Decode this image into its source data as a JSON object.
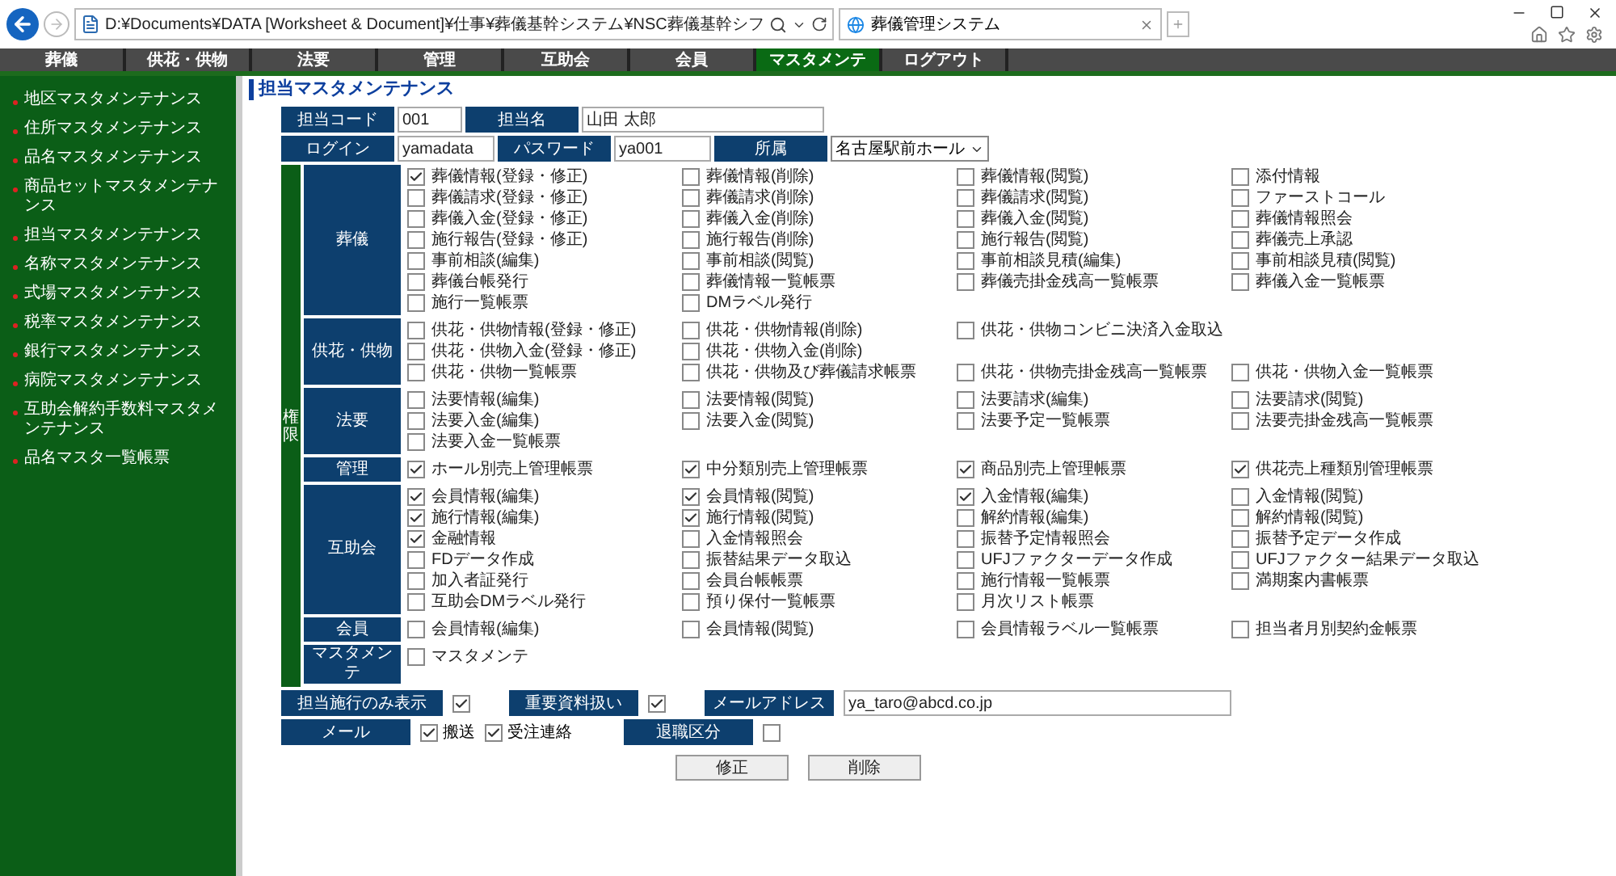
{
  "browser": {
    "address": "D:¥Documents¥DATA [Worksheet & Document]¥仕事¥葬儀基幹システム¥NSC葬儀基幹シフ",
    "tab_title": "葬儀管理システム"
  },
  "nav": [
    {
      "label": "葬儀",
      "selected": false
    },
    {
      "label": "供花・供物",
      "selected": false
    },
    {
      "label": "法要",
      "selected": false
    },
    {
      "label": "管理",
      "selected": false
    },
    {
      "label": "互助会",
      "selected": false
    },
    {
      "label": "会員",
      "selected": false
    },
    {
      "label": "マスタメンテ",
      "selected": true
    },
    {
      "label": "ログアウト",
      "selected": false
    }
  ],
  "sidebar": [
    "地区マスタメンテナンス",
    "住所マスタメンテナンス",
    "品名マスタメンテナンス",
    "商品セットマスタメンテナンス",
    "担当マスタメンテナンス",
    "名称マスタメンテナンス",
    "式場マスタメンテナンス",
    "税率マスタメンテナンス",
    "銀行マスタメンテナンス",
    "病院マスタメンテナンス",
    "互助会解約手数料マスタメンテナンス",
    "品名マスタ一覧帳票"
  ],
  "page_title": "担当マスタメンテナンス",
  "form": {
    "code": {
      "label": "担当コード",
      "value": "001"
    },
    "name": {
      "label": "担当名",
      "value": "山田 太郎"
    },
    "login": {
      "label": "ログイン",
      "value": "yamadata"
    },
    "password": {
      "label": "パスワード",
      "value": "ya001"
    },
    "affiliation": {
      "label": "所属",
      "value": "名古屋駅前ホール"
    },
    "permissions": {
      "label": "権限",
      "sections": [
        {
          "label": "葬儀",
          "rows": [
            [
              {
                "label": "葬儀情報(登録・修正)",
                "checked": true
              },
              {
                "label": "葬儀情報(削除)",
                "checked": false
              },
              {
                "label": "葬儀情報(閲覧)",
                "checked": false
              },
              {
                "label": "添付情報",
                "checked": false
              }
            ],
            [
              {
                "label": "葬儀請求(登録・修正)",
                "checked": false
              },
              {
                "label": "葬儀請求(削除)",
                "checked": false
              },
              {
                "label": "葬儀請求(閲覧)",
                "checked": false
              },
              {
                "label": "ファーストコール",
                "checked": false
              }
            ],
            [
              {
                "label": "葬儀入金(登録・修正)",
                "checked": false
              },
              {
                "label": "葬儀入金(削除)",
                "checked": false
              },
              {
                "label": "葬儀入金(閲覧)",
                "checked": false
              },
              {
                "label": "葬儀情報照会",
                "checked": false
              }
            ],
            [
              {
                "label": "施行報告(登録・修正)",
                "checked": false
              },
              {
                "label": "施行報告(削除)",
                "checked": false
              },
              {
                "label": "施行報告(閲覧)",
                "checked": false
              },
              {
                "label": "葬儀売上承認",
                "checked": false
              }
            ],
            [
              {
                "label": "事前相談(編集)",
                "checked": false
              },
              {
                "label": "事前相談(閲覧)",
                "checked": false
              },
              {
                "label": "事前相談見積(編集)",
                "checked": false
              },
              {
                "label": "事前相談見積(閲覧)",
                "checked": false
              }
            ],
            [
              {
                "label": "葬儀台帳発行",
                "checked": false
              },
              {
                "label": "葬儀情報一覧帳票",
                "checked": false
              },
              {
                "label": "葬儀売掛金残高一覧帳票",
                "checked": false
              },
              {
                "label": "葬儀入金一覧帳票",
                "checked": false
              }
            ],
            [
              {
                "label": "施行一覧帳票",
                "checked": false
              },
              {
                "label": "DMラベル発行",
                "checked": false
              }
            ]
          ]
        },
        {
          "label": "供花・供物",
          "rows": [
            [
              {
                "label": "供花・供物情報(登録・修正)",
                "checked": false
              },
              {
                "label": "供花・供物情報(削除)",
                "checked": false
              },
              {
                "label": "供花・供物コンビニ決済入金取込",
                "checked": false
              }
            ],
            [
              {
                "label": "供花・供物入金(登録・修正)",
                "checked": false
              },
              {
                "label": "供花・供物入金(削除)",
                "checked": false
              }
            ],
            [
              {
                "label": "供花・供物一覧帳票",
                "checked": false
              },
              {
                "label": "供花・供物及び葬儀請求帳票",
                "checked": false
              },
              {
                "label": "供花・供物売掛金残高一覧帳票",
                "checked": false
              },
              {
                "label": "供花・供物入金一覧帳票",
                "checked": false
              }
            ]
          ]
        },
        {
          "label": "法要",
          "rows": [
            [
              {
                "label": "法要情報(編集)",
                "checked": false
              },
              {
                "label": "法要情報(閲覧)",
                "checked": false
              },
              {
                "label": "法要請求(編集)",
                "checked": false
              },
              {
                "label": "法要請求(閲覧)",
                "checked": false
              }
            ],
            [
              {
                "label": "法要入金(編集)",
                "checked": false
              },
              {
                "label": "法要入金(閲覧)",
                "checked": false
              },
              {
                "label": "法要予定一覧帳票",
                "checked": false
              },
              {
                "label": "法要売掛金残高一覧帳票",
                "checked": false
              }
            ],
            [
              {
                "label": "法要入金一覧帳票",
                "checked": false
              }
            ]
          ]
        },
        {
          "label": "管理",
          "rows": [
            [
              {
                "label": "ホール別売上管理帳票",
                "checked": true
              },
              {
                "label": "中分類別売上管理帳票",
                "checked": true
              },
              {
                "label": "商品別売上管理帳票",
                "checked": true
              },
              {
                "label": "供花売上種類別管理帳票",
                "checked": true
              }
            ]
          ]
        },
        {
          "label": "互助会",
          "rows": [
            [
              {
                "label": "会員情報(編集)",
                "checked": true
              },
              {
                "label": "会員情報(閲覧)",
                "checked": true
              },
              {
                "label": "入金情報(編集)",
                "checked": true
              },
              {
                "label": "入金情報(閲覧)",
                "checked": false
              }
            ],
            [
              {
                "label": "施行情報(編集)",
                "checked": true
              },
              {
                "label": "施行情報(閲覧)",
                "checked": true
              },
              {
                "label": "解約情報(編集)",
                "checked": false
              },
              {
                "label": "解約情報(閲覧)",
                "checked": false
              }
            ],
            [
              {
                "label": "金融情報",
                "checked": true
              },
              {
                "label": "入金情報照会",
                "checked": false
              },
              {
                "label": "振替予定情報照会",
                "checked": false
              },
              {
                "label": "振替予定データ作成",
                "checked": false
              }
            ],
            [
              {
                "label": "FDデータ作成",
                "checked": false
              },
              {
                "label": "振替結果データ取込",
                "checked": false
              },
              {
                "label": "UFJファクターデータ作成",
                "checked": false
              },
              {
                "label": "UFJファクター結果データ取込",
                "checked": false
              }
            ],
            [
              {
                "label": "加入者証発行",
                "checked": false
              },
              {
                "label": "会員台帳帳票",
                "checked": false
              },
              {
                "label": "施行情報一覧帳票",
                "checked": false
              },
              {
                "label": "満期案内書帳票",
                "checked": false
              }
            ],
            [
              {
                "label": "互助会DMラベル発行",
                "checked": false
              },
              {
                "label": "預り保付一覧帳票",
                "checked": false
              },
              {
                "label": "月次リスト帳票",
                "checked": false
              }
            ]
          ]
        },
        {
          "label": "会員",
          "rows": [
            [
              {
                "label": "会員情報(編集)",
                "checked": false
              },
              {
                "label": "会員情報(閲覧)",
                "checked": false
              },
              {
                "label": "会員情報ラベル一覧帳票",
                "checked": false
              },
              {
                "label": "担当者月別契約金帳票",
                "checked": false
              }
            ]
          ]
        },
        {
          "label": "マスタメンテ",
          "rows": [
            [
              {
                "label": "マスタメンテ",
                "checked": false
              }
            ]
          ]
        }
      ]
    },
    "staff_only": {
      "label": "担当施行のみ表示",
      "checked": true
    },
    "important": {
      "label": "重要資料扱い",
      "checked": true
    },
    "email": {
      "label": "メールアドレス",
      "value": "ya_taro@abcd.co.jp"
    },
    "mail": {
      "label": "メール",
      "options": [
        {
          "label": "搬送",
          "checked": true
        },
        {
          "label": "受注連絡",
          "checked": true
        }
      ]
    },
    "retired": {
      "label": "退職区分",
      "checked": false
    }
  },
  "buttons": [
    "修正",
    "削除"
  ]
}
